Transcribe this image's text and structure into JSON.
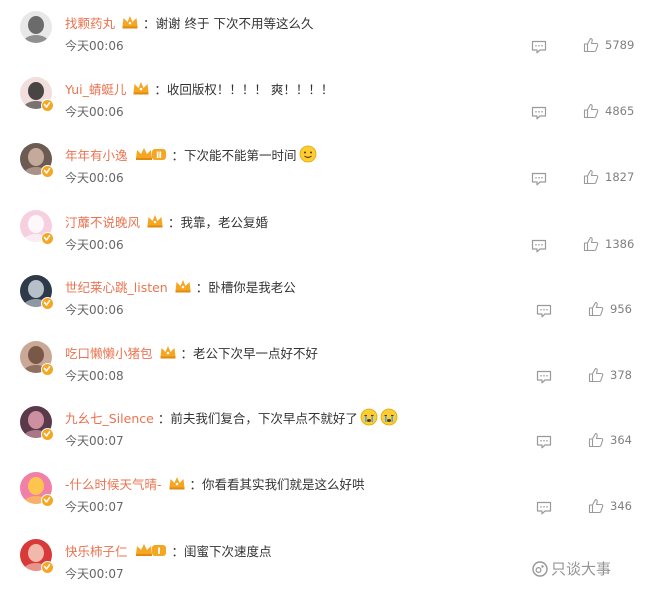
{
  "comments": [
    {
      "username": "找颗药丸",
      "badge": "crown",
      "text": "谢谢 终于 下次不用等这么久",
      "time": "今天00:06",
      "likes": "5789",
      "emoji": "",
      "avatar_color": "#e8e8e8",
      "avatar_accent": "#555555"
    },
    {
      "username": "Yui_蜻蜓儿",
      "badge": "crown",
      "text": "收回版权！！！！ 爽！！！！",
      "time": "今天00:06",
      "likes": "4865",
      "emoji": "",
      "avatar_color": "#f3dede",
      "avatar_accent": "#2a2a2a"
    },
    {
      "username": "年年有小逸",
      "badge": "crown-level",
      "badge_level": "Ⅱ",
      "text": "下次能不能第一时间",
      "time": "今天00:06",
      "likes": "1827",
      "emoji": "smile",
      "avatar_color": "#6b5b53",
      "avatar_accent": "#d4b8a8"
    },
    {
      "username": "汀蘼不说晚风",
      "badge": "crown",
      "text": "我靠，老公复婚",
      "time": "今天00:06",
      "likes": "1386",
      "emoji": "",
      "avatar_color": "#f6cfe0",
      "avatar_accent": "#ffffff"
    },
    {
      "username": "世纪莱心跳_listen",
      "badge": "crown",
      "text": "卧槽你是我老公",
      "time": "今天00:06",
      "likes": "956",
      "emoji": "",
      "avatar_color": "#2e3a4a",
      "avatar_accent": "#cfd8e0"
    },
    {
      "username": "吃口懒懒小猪包",
      "badge": "crown",
      "text": "老公下次早一点好不好",
      "time": "今天00:08",
      "likes": "378",
      "emoji": "",
      "avatar_color": "#c9a898",
      "avatar_accent": "#6b4a3a"
    },
    {
      "username": "九幺七_Silence",
      "badge": "",
      "text": "前夫我们复合，下次早点不就好了",
      "time": "今天00:07",
      "likes": "364",
      "emoji": "cry-cry",
      "avatar_color": "#5a3a4a",
      "avatar_accent": "#e0a0b0"
    },
    {
      "username": "-什么时候天气晴-",
      "badge": "crown",
      "text": "你看看其实我们就是这么好哄",
      "time": "今天00:07",
      "likes": "346",
      "emoji": "",
      "avatar_color": "#f080a8",
      "avatar_accent": "#ffd040"
    },
    {
      "username": "快乐柿子仁",
      "badge": "crown-level",
      "badge_level": "Ⅰ",
      "text": "闺蜜下次速度点",
      "time": "今天00:07",
      "likes": "",
      "emoji": "",
      "avatar_color": "#d83a3a",
      "avatar_accent": "#f5d0c0"
    }
  ],
  "watermark": {
    "text": "只谈大事"
  },
  "colors": {
    "username": "#eb7350",
    "text": "#333333",
    "time": "#666666",
    "icon": "#9a9a9a",
    "crown": "#f5a623"
  },
  "icons": {
    "reply": "comment-icon",
    "like": "thumbs-up-icon",
    "verified": "verified-v-icon",
    "badge": "crown-badge-icon"
  }
}
